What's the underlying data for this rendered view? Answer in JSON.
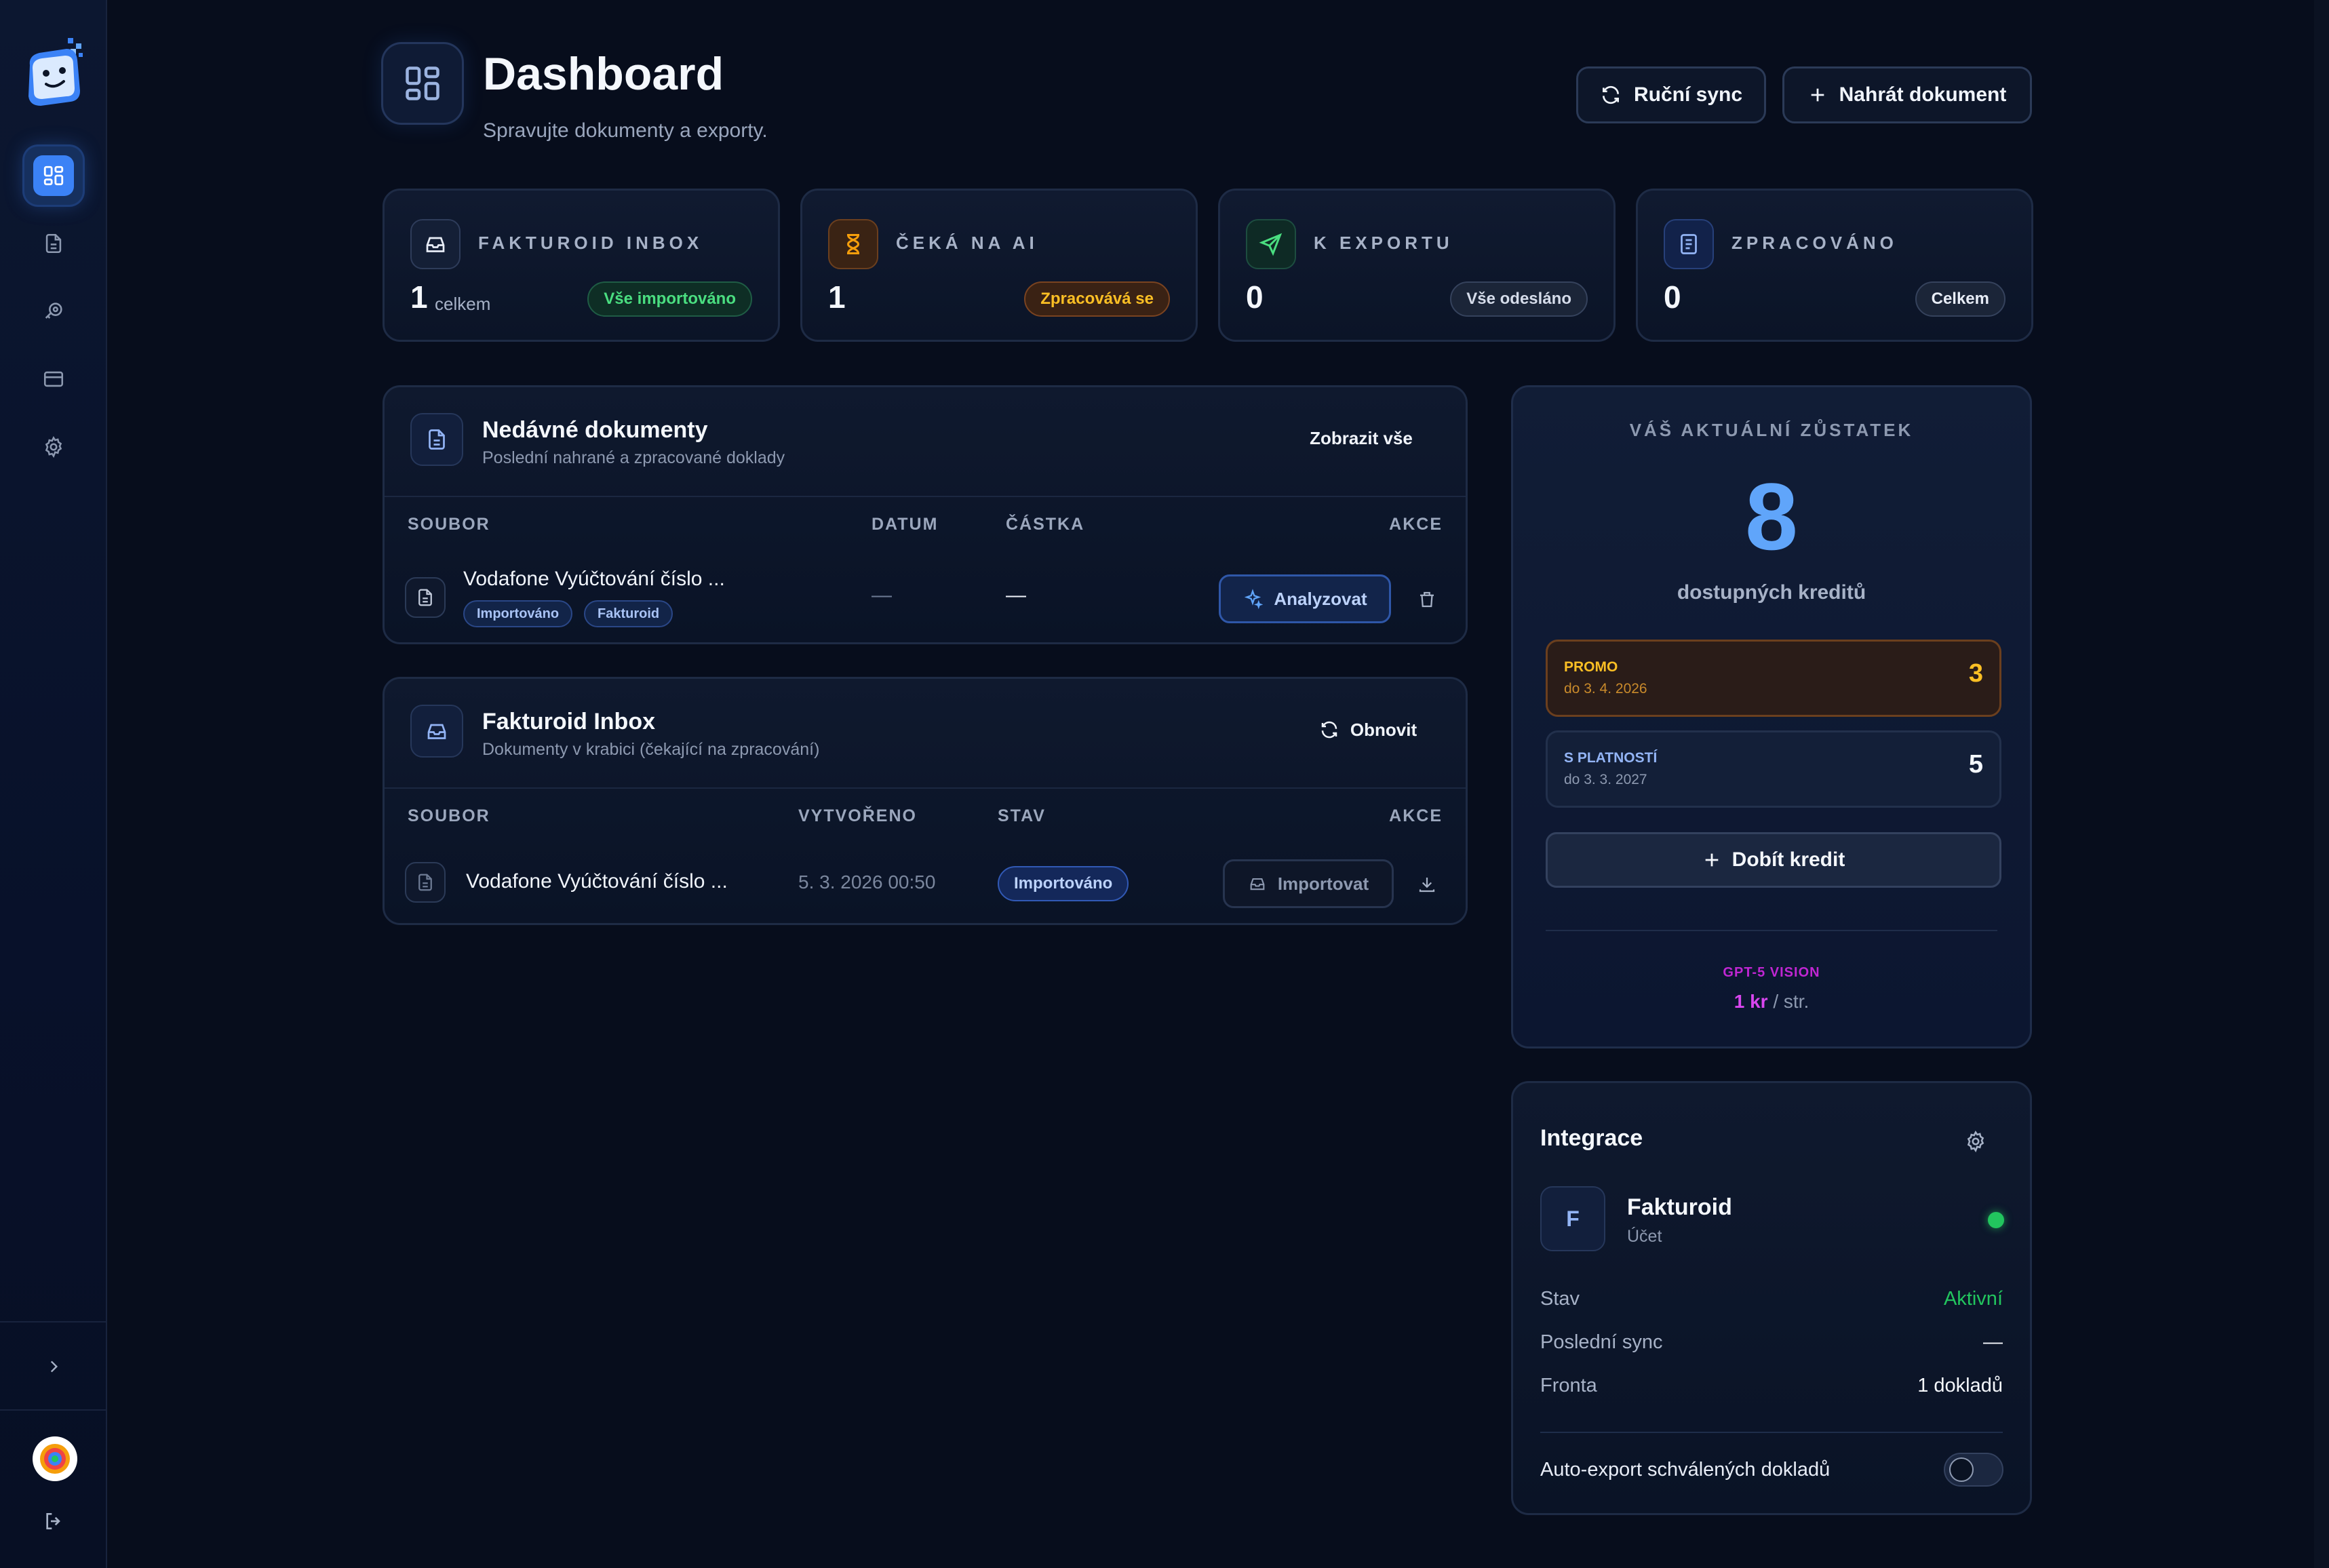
{
  "header": {
    "title": "Dashboard",
    "subtitle": "Spravujte dokumenty a exporty.",
    "sync_label": "Ruční sync",
    "upload_label": "Nahrát dokument"
  },
  "stats": [
    {
      "label": "FAKTUROID INBOX",
      "value": "1",
      "unit": "celkem",
      "badge": "Vše importováno"
    },
    {
      "label": "ČEKÁ NA AI",
      "value": "1",
      "badge": "Zpracovává se"
    },
    {
      "label": "K EXPORTU",
      "value": "0",
      "badge": "Vše odesláno"
    },
    {
      "label": "ZPRACOVÁNO",
      "value": "0",
      "badge": "Celkem"
    }
  ],
  "recent": {
    "title": "Nedávné dokumenty",
    "subtitle": "Poslední nahrané a zpracované doklady",
    "show_all": "Zobrazit vše",
    "columns": [
      "SOUBOR",
      "DATUM",
      "ČÁSTKA",
      "AKCE"
    ],
    "rows": [
      {
        "file": "Vodafone Vyúčtování číslo ...",
        "date": "—",
        "amount": "—",
        "tags": [
          "Importováno",
          "Fakturoid"
        ],
        "action": "Analyzovat"
      }
    ]
  },
  "inbox": {
    "title": "Fakturoid Inbox",
    "subtitle": "Dokumenty v krabici (čekající na zpracování)",
    "refresh": "Obnovit",
    "columns": [
      "SOUBOR",
      "VYTVOŘENO",
      "STAV",
      "AKCE"
    ],
    "rows": [
      {
        "file": "Vodafone Vyúčtování číslo ...",
        "created": "5. 3. 2026 00:50",
        "status": "Importováno",
        "action": "Importovat"
      }
    ]
  },
  "credit": {
    "heading": "VÁŠ AKTUÁLNÍ ZŮSTATEK",
    "value": "8",
    "caption": "dostupných kreditů",
    "tiers": [
      {
        "name": "PROMO",
        "valid": "do 3. 4. 2026",
        "amount": "3"
      },
      {
        "name": "S PLATNOSTÍ",
        "valid": "do 3. 3. 2027",
        "amount": "5"
      }
    ],
    "topup": "Dobít kredit",
    "model": "GPT-5 VISION",
    "price": "1 kr",
    "price_unit": "/ str."
  },
  "integration": {
    "title": "Integrace",
    "avatar_letter": "F",
    "name": "Fakturoid",
    "sub": "Účet",
    "rows": [
      {
        "label": "Stav",
        "value": "Aktivní"
      },
      {
        "label": "Poslední sync",
        "value": "—"
      },
      {
        "label": "Fronta",
        "value": "1 dokladů"
      }
    ],
    "auto_export": "Auto-export schválených dokladů",
    "auto_export_on": false
  },
  "colors": {
    "accent": "#3b82f6",
    "success": "#22c55e",
    "warning": "#f59e0b",
    "promo": "#fbbf24",
    "purple": "#c026d3"
  }
}
